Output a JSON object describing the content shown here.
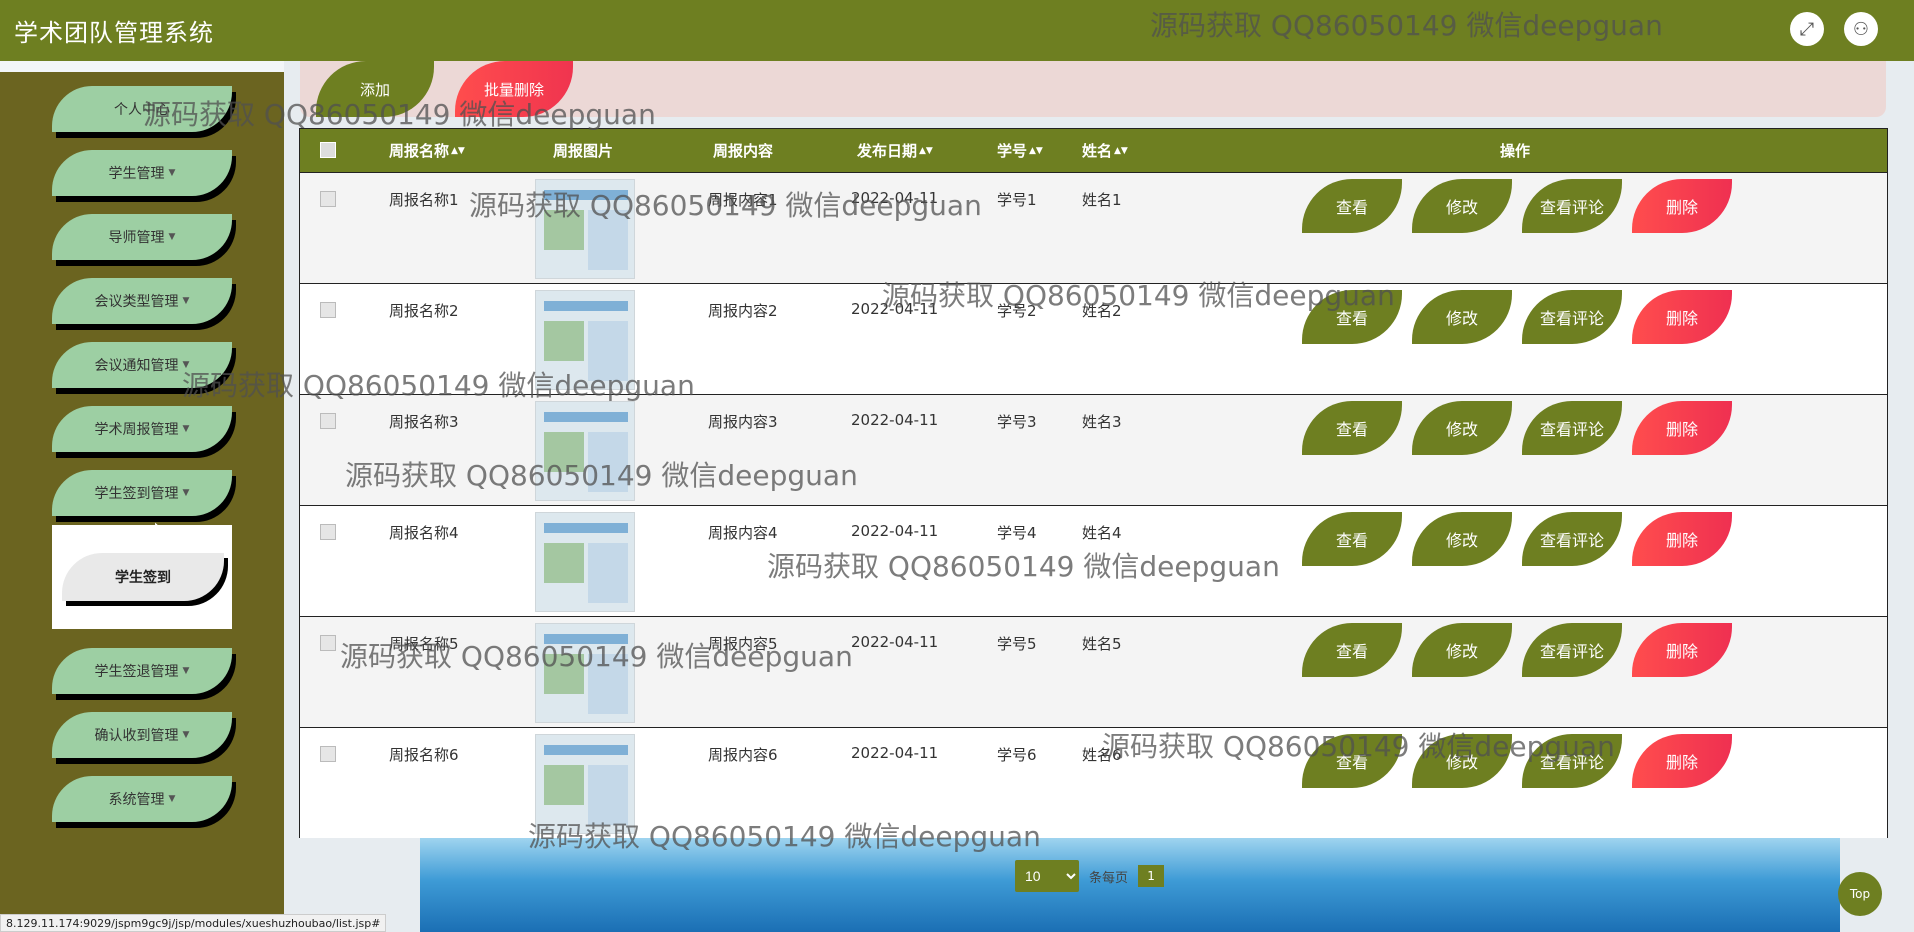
{
  "header": {
    "title": "学术团队管理系统",
    "fullscreen_icon": "expand-icon",
    "user_icon": "user-icon"
  },
  "sidebar": {
    "items": [
      {
        "label": "个人中心"
      },
      {
        "label": "学生管理"
      },
      {
        "label": "导师管理"
      },
      {
        "label": "会议类型管理"
      },
      {
        "label": "会议通知管理"
      },
      {
        "label": "学术周报管理"
      },
      {
        "label": "学生签到管理"
      },
      {
        "label": "学生签退管理"
      },
      {
        "label": "确认收到管理"
      },
      {
        "label": "系统管理"
      }
    ],
    "submenu": {
      "label": "学生签到"
    }
  },
  "actions": {
    "add": "添加",
    "batch_delete": "批量删除"
  },
  "table": {
    "headers": {
      "name": "周报名称",
      "image": "周报图片",
      "content": "周报内容",
      "date": "发布日期",
      "student_id": "学号",
      "student_name": "姓名",
      "ops": "操作"
    },
    "ops": {
      "view": "查看",
      "edit": "修改",
      "comments": "查看评论",
      "delete": "删除"
    },
    "rows": [
      {
        "name": "周报名称1",
        "content": "周报内容1",
        "date": "2022-04-11",
        "student_id": "学号1",
        "student_name": "姓名1"
      },
      {
        "name": "周报名称2",
        "content": "周报内容2",
        "date": "2022-04-11",
        "student_id": "学号2",
        "student_name": "姓名2"
      },
      {
        "name": "周报名称3",
        "content": "周报内容3",
        "date": "2022-04-11",
        "student_id": "学号3",
        "student_name": "姓名3"
      },
      {
        "name": "周报名称4",
        "content": "周报内容4",
        "date": "2022-04-11",
        "student_id": "学号4",
        "student_name": "姓名4"
      },
      {
        "name": "周报名称5",
        "content": "周报内容5",
        "date": "2022-04-11",
        "student_id": "学号5",
        "student_name": "姓名5"
      },
      {
        "name": "周报名称6",
        "content": "周报内容6",
        "date": "2022-04-11",
        "student_id": "学号6",
        "student_name": "姓名6"
      }
    ]
  },
  "pagination": {
    "page_size": "10",
    "per_page_label": "条每页",
    "current_page": "1"
  },
  "top_button": "Top",
  "status_url": "8.129.11.174:9029/jspm9gc9j/jsp/modules/xueshuzhoubao/list.jsp#",
  "watermark": "源码获取 QQ86050149 微信deepguan",
  "colors": {
    "primary": "#6e7f21",
    "sidebar_bg": "#6b6420",
    "menu_item": "#9dcfa3",
    "danger": "#ef3051"
  }
}
